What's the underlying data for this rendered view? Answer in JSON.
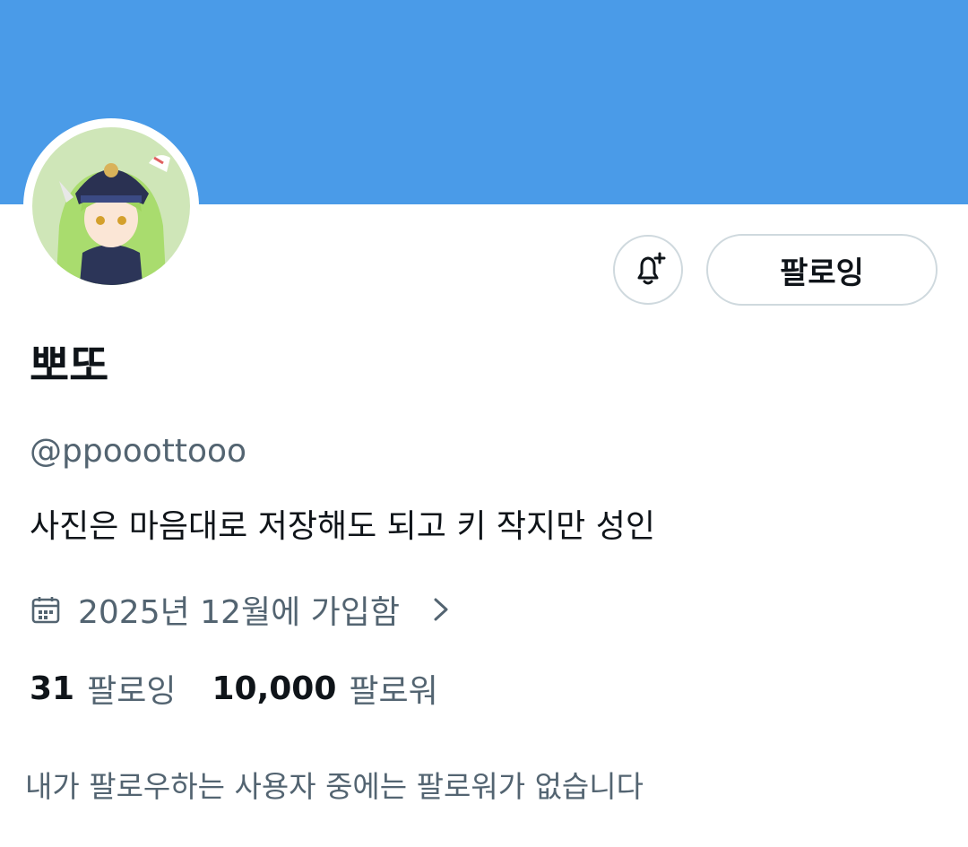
{
  "colors": {
    "banner": "#4a9be8",
    "text_primary": "#0f1419",
    "text_secondary": "#536471",
    "border": "#cfd9de"
  },
  "profile": {
    "display_name": "뽀또",
    "handle": "@ppooottooo",
    "bio": "사진은 마음대로 저장해도 되고 키 작지만 성인",
    "joined": "2025년 12월에 가입함",
    "avatar_icon": "profile-avatar"
  },
  "actions": {
    "notify_icon": "bell-plus-icon",
    "follow_label": "팔로잉"
  },
  "stats": {
    "following_count": "31",
    "following_label": "팔로잉",
    "followers_count": "10,000",
    "followers_label": "팔로워"
  },
  "footer": {
    "mutual_note": "내가 팔로우하는 사용자 중에는 팔로워가 없습니다"
  }
}
